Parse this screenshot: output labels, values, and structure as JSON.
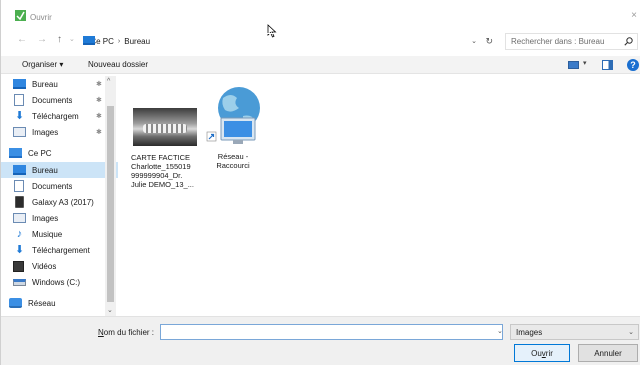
{
  "window": {
    "title": "Ouvrir",
    "close_glyph": "×",
    "accent": "#1a6fd0"
  },
  "nav": {
    "back": "←",
    "forward": "→",
    "up": "↑"
  },
  "address": {
    "crumbs": [
      "Ce PC",
      "Bureau"
    ],
    "separator": "›",
    "dropdown": "⌄",
    "refresh": "↻"
  },
  "search": {
    "placeholder": "Rechercher dans : Bureau"
  },
  "toolbar": {
    "organize": "Organiser ▾",
    "new_folder": "Nouveau dossier",
    "view_dd": "▾",
    "help": "?"
  },
  "sidebar": {
    "items": [
      {
        "label": "Bureau",
        "icon": "desktop-icon",
        "pinned": true
      },
      {
        "label": "Documents",
        "icon": "documents-icon",
        "pinned": true
      },
      {
        "label": "Téléchargem",
        "icon": "downloads-icon",
        "pinned": true
      },
      {
        "label": "Images",
        "icon": "pictures-icon",
        "pinned": true
      },
      {
        "label": "Ce PC",
        "icon": "computer-icon"
      },
      {
        "label": "Bureau",
        "icon": "desktop-icon",
        "selected": true
      },
      {
        "label": "Documents",
        "icon": "documents-icon"
      },
      {
        "label": "Galaxy A3 (2017)",
        "icon": "phone-icon"
      },
      {
        "label": "Images",
        "icon": "pictures-icon"
      },
      {
        "label": "Musique",
        "icon": "music-icon"
      },
      {
        "label": "Téléchargement",
        "icon": "downloads-icon"
      },
      {
        "label": "Vidéos",
        "icon": "videos-icon"
      },
      {
        "label": "Windows (C:)",
        "icon": "drive-icon"
      },
      {
        "label": "Réseau",
        "icon": "network-icon"
      }
    ],
    "pin_glyph": "✱",
    "scroll_up": "^",
    "scroll_down": "⌄"
  },
  "files": [
    {
      "label": "CARTE FACTICE Charlotte_155019 999999904_Dr. Julie DEMO_13_...",
      "icon": "xray-thumbnail"
    },
    {
      "label": "Réseau - Raccourci",
      "icon": "network-shortcut-icon"
    }
  ],
  "bottom": {
    "filename_label_prefix": "N",
    "filename_label_rest": "om du fichier :",
    "filename_value": "",
    "filetype": "Images",
    "open_prefix": "Ou",
    "open_u": "v",
    "open_rest": "rir",
    "cancel": "Annuler"
  }
}
